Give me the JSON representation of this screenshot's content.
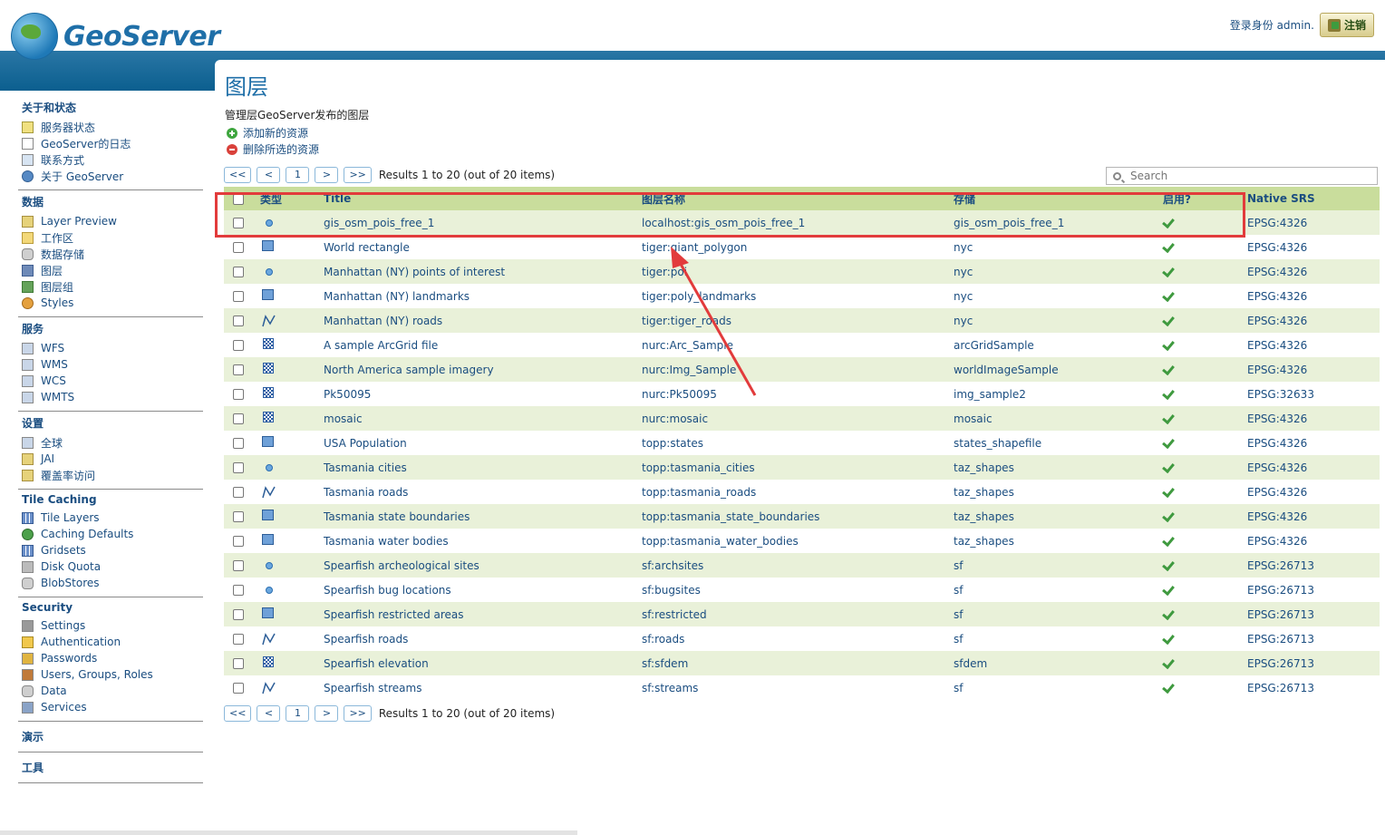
{
  "header": {
    "logo_text": "GeoServer",
    "login_text": "登录身份 admin.",
    "logout_label": "注销"
  },
  "sidebar": {
    "sections": [
      {
        "title": "关于和状态",
        "items": [
          {
            "label": "服务器状态",
            "icon": "status"
          },
          {
            "label": "GeoServer的日志",
            "icon": "doc"
          },
          {
            "label": "联系方式",
            "icon": "contact"
          },
          {
            "label": "关于 GeoServer",
            "icon": "info"
          }
        ]
      },
      {
        "title": "数据",
        "items": [
          {
            "label": "Layer Preview",
            "icon": "map"
          },
          {
            "label": "工作区",
            "icon": "folder"
          },
          {
            "label": "数据存储",
            "icon": "db"
          },
          {
            "label": "图层",
            "icon": "layer"
          },
          {
            "label": "图层组",
            "icon": "group"
          },
          {
            "label": "Styles",
            "icon": "style"
          }
        ]
      },
      {
        "title": "服务",
        "items": [
          {
            "label": "WFS",
            "icon": "svc"
          },
          {
            "label": "WMS",
            "icon": "svc"
          },
          {
            "label": "WCS",
            "icon": "svc"
          },
          {
            "label": "WMTS",
            "icon": "svc"
          }
        ]
      },
      {
        "title": "设置",
        "items": [
          {
            "label": "全球",
            "icon": "svc"
          },
          {
            "label": "JAI",
            "icon": "map"
          },
          {
            "label": "覆盖率访问",
            "icon": "map"
          }
        ]
      },
      {
        "title": "Tile Caching",
        "items": [
          {
            "label": "Tile Layers",
            "icon": "grid"
          },
          {
            "label": "Caching Defaults",
            "icon": "globe2"
          },
          {
            "label": "Gridsets",
            "icon": "grid"
          },
          {
            "label": "Disk Quota",
            "icon": "disk"
          },
          {
            "label": "BlobStores",
            "icon": "db"
          }
        ]
      },
      {
        "title": "Security",
        "items": [
          {
            "label": "Settings",
            "icon": "key"
          },
          {
            "label": "Authentication",
            "icon": "shield"
          },
          {
            "label": "Passwords",
            "icon": "lock"
          },
          {
            "label": "Users, Groups, Roles",
            "icon": "users"
          },
          {
            "label": "Data",
            "icon": "db"
          },
          {
            "label": "Services",
            "icon": "pen"
          }
        ]
      },
      {
        "title": "演示",
        "items": []
      },
      {
        "title": "工具",
        "items": []
      }
    ]
  },
  "main": {
    "title": "图层",
    "description": "管理层GeoServer发布的图层",
    "add_label": "添加新的资源",
    "delete_label": "删除所选的资源",
    "pager": {
      "first": "<<",
      "prev": "<",
      "page": "1",
      "next": ">",
      "last": ">>",
      "summary": "Results 1 to 20 (out of 20 items)"
    },
    "search_placeholder": "Search",
    "columns": {
      "type": "类型",
      "title": "Title",
      "name": "图层名称",
      "store": "存储",
      "enabled": "启用?",
      "srs": "Native SRS"
    },
    "rows": [
      {
        "type": "point",
        "title": "gis_osm_pois_free_1",
        "name": "localhost:gis_osm_pois_free_1",
        "store": "gis_osm_pois_free_1",
        "srs": "EPSG:4326"
      },
      {
        "type": "polygon",
        "title": "World rectangle",
        "name": "tiger:giant_polygon",
        "store": "nyc",
        "srs": "EPSG:4326"
      },
      {
        "type": "point",
        "title": "Manhattan (NY) points of interest",
        "name": "tiger:poi",
        "store": "nyc",
        "srs": "EPSG:4326"
      },
      {
        "type": "polygon",
        "title": "Manhattan (NY) landmarks",
        "name": "tiger:poly_landmarks",
        "store": "nyc",
        "srs": "EPSG:4326"
      },
      {
        "type": "line",
        "title": "Manhattan (NY) roads",
        "name": "tiger:tiger_roads",
        "store": "nyc",
        "srs": "EPSG:4326"
      },
      {
        "type": "raster",
        "title": "A sample ArcGrid file",
        "name": "nurc:Arc_Sample",
        "store": "arcGridSample",
        "srs": "EPSG:4326"
      },
      {
        "type": "raster",
        "title": "North America sample imagery",
        "name": "nurc:Img_Sample",
        "store": "worldImageSample",
        "srs": "EPSG:4326"
      },
      {
        "type": "raster",
        "title": "Pk50095",
        "name": "nurc:Pk50095",
        "store": "img_sample2",
        "srs": "EPSG:32633"
      },
      {
        "type": "raster",
        "title": "mosaic",
        "name": "nurc:mosaic",
        "store": "mosaic",
        "srs": "EPSG:4326"
      },
      {
        "type": "polygon",
        "title": "USA Population",
        "name": "topp:states",
        "store": "states_shapefile",
        "srs": "EPSG:4326"
      },
      {
        "type": "point",
        "title": "Tasmania cities",
        "name": "topp:tasmania_cities",
        "store": "taz_shapes",
        "srs": "EPSG:4326"
      },
      {
        "type": "line",
        "title": "Tasmania roads",
        "name": "topp:tasmania_roads",
        "store": "taz_shapes",
        "srs": "EPSG:4326"
      },
      {
        "type": "polygon",
        "title": "Tasmania state boundaries",
        "name": "topp:tasmania_state_boundaries",
        "store": "taz_shapes",
        "srs": "EPSG:4326"
      },
      {
        "type": "polygon",
        "title": "Tasmania water bodies",
        "name": "topp:tasmania_water_bodies",
        "store": "taz_shapes",
        "srs": "EPSG:4326"
      },
      {
        "type": "point",
        "title": "Spearfish archeological sites",
        "name": "sf:archsites",
        "store": "sf",
        "srs": "EPSG:26713"
      },
      {
        "type": "point",
        "title": "Spearfish bug locations",
        "name": "sf:bugsites",
        "store": "sf",
        "srs": "EPSG:26713"
      },
      {
        "type": "polygon",
        "title": "Spearfish restricted areas",
        "name": "sf:restricted",
        "store": "sf",
        "srs": "EPSG:26713"
      },
      {
        "type": "line",
        "title": "Spearfish roads",
        "name": "sf:roads",
        "store": "sf",
        "srs": "EPSG:26713"
      },
      {
        "type": "raster",
        "title": "Spearfish elevation",
        "name": "sf:sfdem",
        "store": "sfdem",
        "srs": "EPSG:26713"
      },
      {
        "type": "line",
        "title": "Spearfish streams",
        "name": "sf:streams",
        "store": "sf",
        "srs": "EPSG:26713"
      }
    ]
  }
}
